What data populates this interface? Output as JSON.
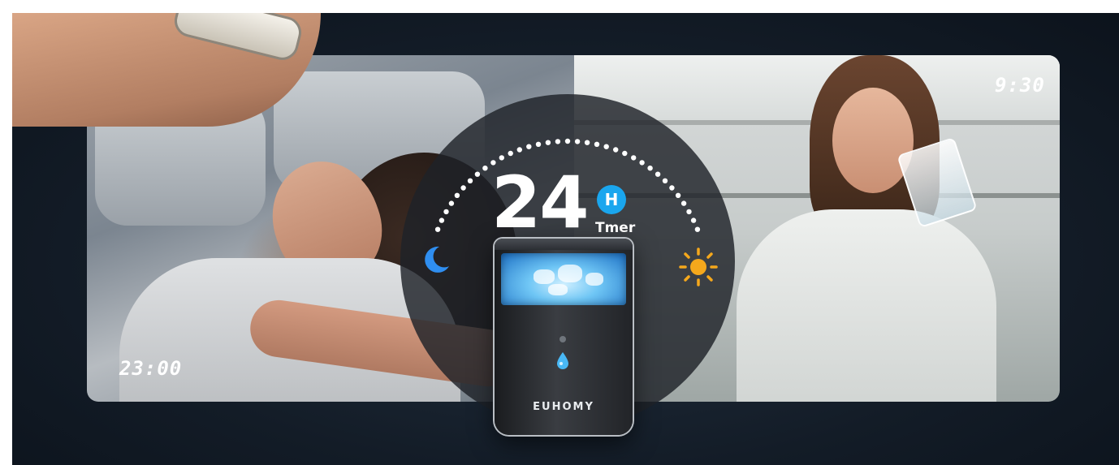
{
  "scene": {
    "night_time": "23:00",
    "day_time": "9:30"
  },
  "timer": {
    "hours": "24",
    "unit_badge": "H",
    "label": "Tmer"
  },
  "product": {
    "brand": "EUHOMY"
  },
  "icons": {
    "night": "moon-icon",
    "day": "sun-icon",
    "water": "water-drop-icon"
  },
  "colors": {
    "accent_blue": "#1aa6ee",
    "moon": "#2f8ef0",
    "sun": "#f5a81c",
    "background": "#131c27"
  }
}
